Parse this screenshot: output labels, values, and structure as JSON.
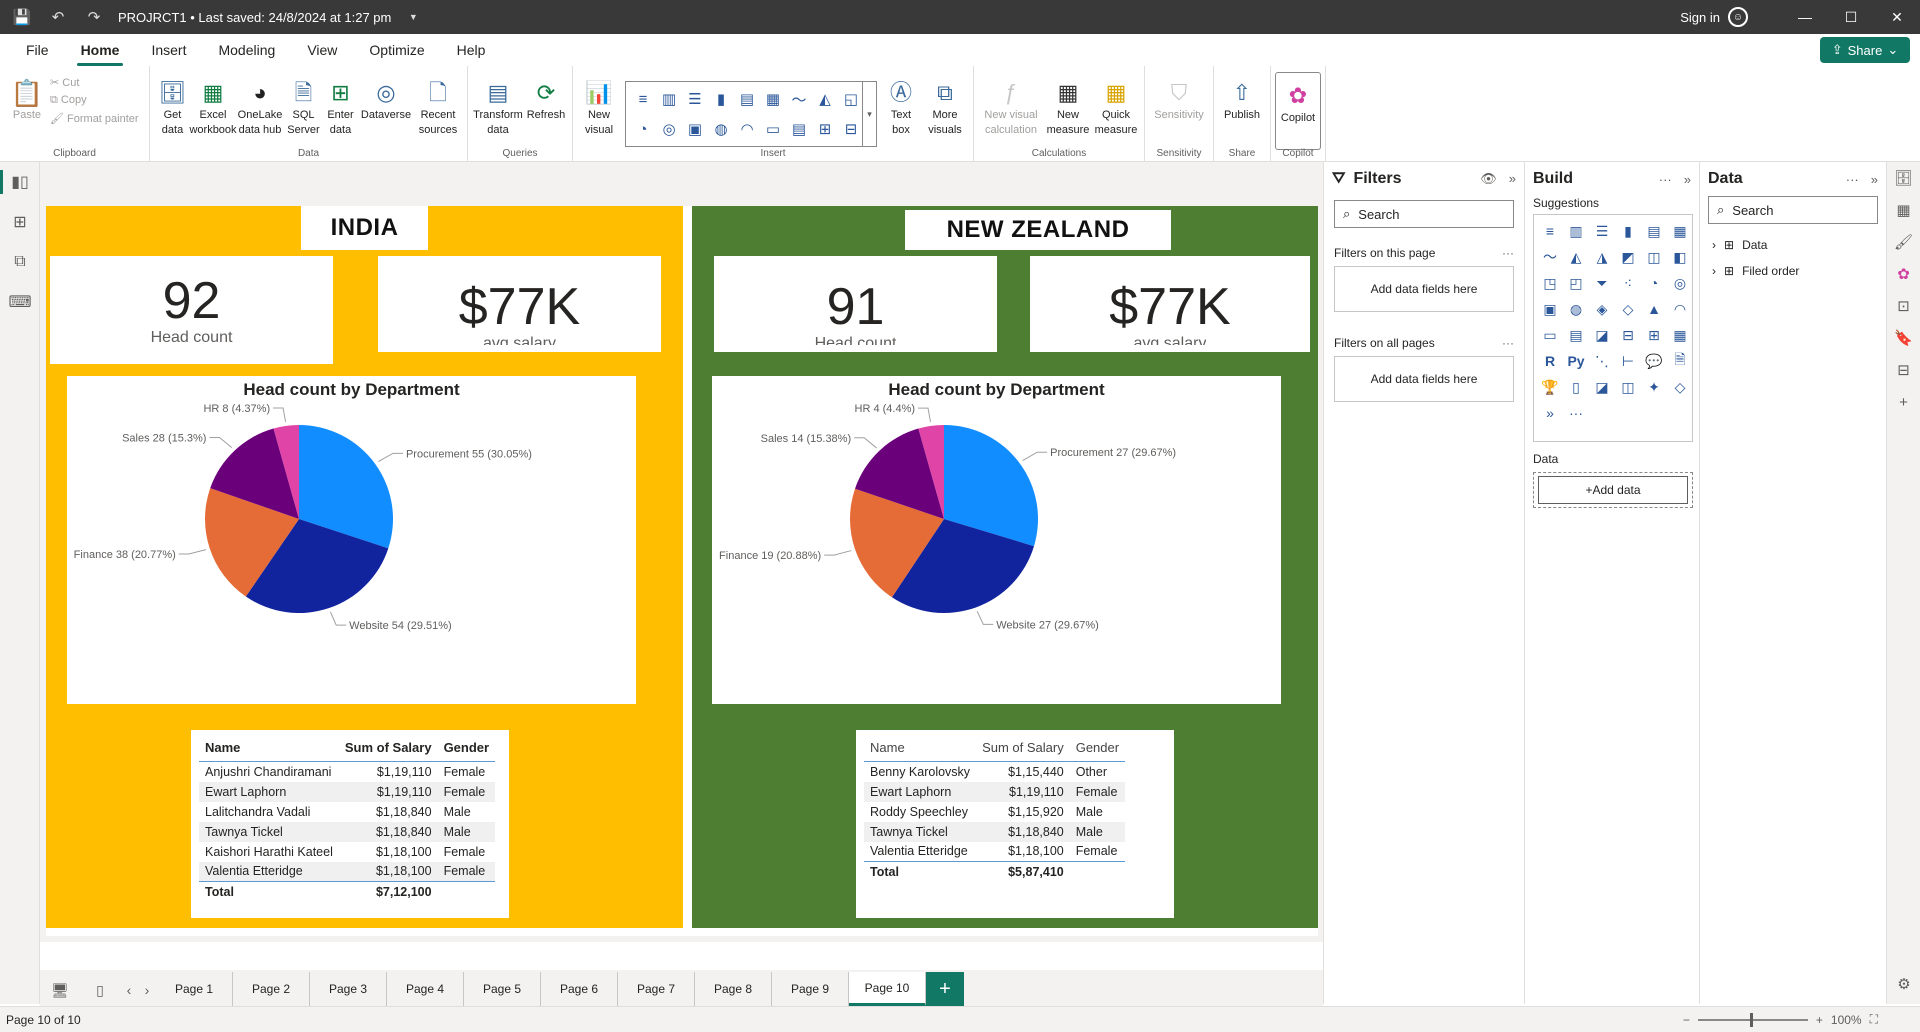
{
  "titlebar": {
    "title": "PROJRCT1 • Last saved: 24/8/2024 at 1:27 pm",
    "signin": "Sign in"
  },
  "menu": [
    "File",
    "Home",
    "Insert",
    "Modeling",
    "View",
    "Optimize",
    "Help"
  ],
  "share": "Share",
  "ribbon": {
    "clipboard": {
      "paste": "Paste",
      "cut": "Cut",
      "copy": "Copy",
      "format_painter": "Format painter",
      "label": "Clipboard"
    },
    "data": {
      "buttons": [
        "Get data",
        "Excel workbook",
        "OneLake data hub",
        "SQL Server",
        "Enter data",
        "Dataverse",
        "Recent sources"
      ],
      "label": "Data"
    },
    "queries": {
      "buttons": [
        "Transform data",
        "Refresh"
      ],
      "label": "Queries"
    },
    "insert": {
      "buttons": [
        "New visual",
        "Text box",
        "More visuals"
      ],
      "label": "Insert"
    },
    "calculations": {
      "buttons": [
        "New visual calculation",
        "New measure",
        "Quick measure"
      ],
      "label": "Calculations"
    },
    "sensitivity": {
      "buttons": [
        "Sensitivity"
      ],
      "label": "Sensitivity"
    },
    "share": {
      "buttons": [
        "Publish"
      ],
      "label": "Share"
    },
    "copilot": {
      "buttons": [
        "Copilot"
      ],
      "label": "Copilot"
    }
  },
  "india": {
    "title": "INDIA",
    "headcount": {
      "value": "92",
      "label": "Head count"
    },
    "salary": {
      "value": "$77K",
      "label": "avg salary"
    },
    "chart_title": "Head count by Department",
    "table": {
      "headers": [
        "Name",
        "Sum of Salary",
        "Gender"
      ],
      "rows": [
        [
          "Anjushri Chandiramani",
          "$1,19,110",
          "Female"
        ],
        [
          "Ewart Laphorn",
          "$1,19,110",
          "Female"
        ],
        [
          "Lalitchandra Vadali",
          "$1,18,840",
          "Male"
        ],
        [
          "Tawnya Tickel",
          "$1,18,840",
          "Male"
        ],
        [
          "Kaishori Harathi Kateel",
          "$1,18,100",
          "Female"
        ],
        [
          "Valentia Etteridge",
          "$1,18,100",
          "Female"
        ]
      ],
      "total_label": "Total",
      "total_value": "$7,12,100"
    }
  },
  "nz": {
    "title": "NEW ZEALAND",
    "headcount": {
      "value": "91",
      "label": "Head count"
    },
    "salary": {
      "value": "$77K",
      "label": "avg salary"
    },
    "chart_title": "Head count by Department",
    "table": {
      "headers": [
        "Name",
        "Sum of Salary",
        "Gender"
      ],
      "rows": [
        [
          "Benny Karolovsky",
          "$1,15,440",
          "Other"
        ],
        [
          "Ewart Laphorn",
          "$1,19,110",
          "Female"
        ],
        [
          "Roddy Speechley",
          "$1,15,920",
          "Male"
        ],
        [
          "Tawnya Tickel",
          "$1,18,840",
          "Male"
        ],
        [
          "Valentia Etteridge",
          "$1,18,100",
          "Female"
        ]
      ],
      "total_label": "Total",
      "total_value": "$5,87,410"
    }
  },
  "chart_data": [
    {
      "type": "pie",
      "title": "Head count by Department",
      "slices": [
        {
          "label": "Procurement 55 (30.05%)",
          "value": 55,
          "color": "#118dff"
        },
        {
          "label": "Website 54 (29.51%)",
          "value": 54,
          "color": "#12239e"
        },
        {
          "label": "Finance 38 (20.77%)",
          "value": 38,
          "color": "#e66c37"
        },
        {
          "label": "Sales 28 (15.3%)",
          "value": 28,
          "color": "#6b007b"
        },
        {
          "label": "HR 8 (4.37%)",
          "value": 8,
          "color": "#e044a7"
        }
      ]
    },
    {
      "type": "pie",
      "title": "Head count by Department",
      "slices": [
        {
          "label": "Procurement 27 (29.67%)",
          "value": 27,
          "color": "#118dff"
        },
        {
          "label": "Website 27 (29.67%)",
          "value": 27,
          "color": "#12239e"
        },
        {
          "label": "Finance 19 (20.88%)",
          "value": 19,
          "color": "#e66c37"
        },
        {
          "label": "Sales 14 (15.38%)",
          "value": 14,
          "color": "#6b007b"
        },
        {
          "label": "HR 4 (4.4%)",
          "value": 4,
          "color": "#e044a7"
        }
      ]
    }
  ],
  "filters": {
    "title": "Filters",
    "search": "Search",
    "on_page": "Filters on this page",
    "on_all": "Filters on all pages",
    "add": "Add data fields here"
  },
  "build": {
    "title": "Build",
    "suggestions": "Suggestions",
    "data": "Data",
    "add_data": "+Add data"
  },
  "datapane": {
    "title": "Data",
    "search": "Search",
    "items": [
      "Data",
      "Filed order"
    ]
  },
  "tabs": [
    "Page 1",
    "Page 2",
    "Page 3",
    "Page 4",
    "Page 5",
    "Page 6",
    "Page 7",
    "Page 8",
    "Page 9",
    "Page 10"
  ],
  "status": {
    "page": "Page 10 of 10",
    "zoom": "100%"
  }
}
